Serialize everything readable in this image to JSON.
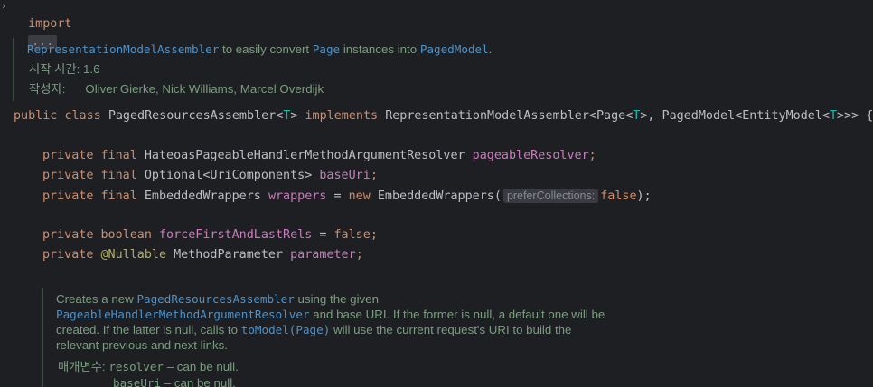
{
  "editor": {
    "fold_marker": "›",
    "import_keyword": "import",
    "import_folded": "...",
    "javadoc_class": {
      "link_assembler": "RepresentationModelAssembler",
      "text_1": " to easily convert ",
      "link_page": "Page",
      "text_2": " instances into ",
      "link_pagedmodel": "PagedModel",
      "text_3": ".",
      "since_label": "시작 시간:",
      "since_value": "1.6",
      "author_label": "작성자:",
      "author_value": "Oliver Gierke, Nick Williams, Marcel Overdijk"
    },
    "class_decl": {
      "kw_public": "public",
      "kw_class": "class",
      "class_name": "PagedResourcesAssembler",
      "lt1": "<",
      "tparam1": "T",
      "gt1": ">",
      "kw_implements": "implements",
      "rest_a": "RepresentationModelAssembler<Page<",
      "tparam2": "T",
      "rest_b": ">, PagedModel<EntityModel<",
      "tparam3": "T",
      "rest_c": ">>> {"
    },
    "fields": [
      {
        "mods": "private final",
        "type": "HateoasPageableHandlerMethodArgumentResolver",
        "name": "pageableResolver",
        "tail": ";"
      },
      {
        "mods": "private final",
        "type": "Optional<UriComponents>",
        "name": "baseUri",
        "tail": ";"
      },
      {
        "mods": "private final",
        "type": "EmbeddedWrappers",
        "name": "wrappers",
        "assign": " = ",
        "kw_new": "new",
        "ctor": "EmbeddedWrappers(",
        "hint": "preferCollections:",
        "arg": "false",
        "tail": ");"
      },
      {
        "mods": "private",
        "kw_type": "boolean",
        "name": "forceFirstAndLastRels",
        "assign": " = ",
        "value_kw": "false",
        "tail": ";"
      },
      {
        "mods": "private",
        "annotation": "@Nullable",
        "type": "MethodParameter",
        "name": "parameter",
        "tail": ";"
      }
    ],
    "javadoc_ctor": {
      "l1_a": "Creates a new ",
      "l1_link": "PagedResourcesAssembler",
      "l1_b": " using the given",
      "l2_link": "PageableHandlerMethodArgumentResolver",
      "l2_b": " and base URI. If the former is null, a default one will be",
      "l3_a": "created. If the latter is null, calls to ",
      "l3_link": "toModel(Page)",
      "l3_b": " will use the current request's URI to build the",
      "l4": "relevant previous and next links.",
      "params_label": "매개변수:",
      "p1_name": "resolver",
      "p1_desc": " – can be null.",
      "p2_name": "baseUri",
      "p2_desc": " – can be null."
    }
  }
}
